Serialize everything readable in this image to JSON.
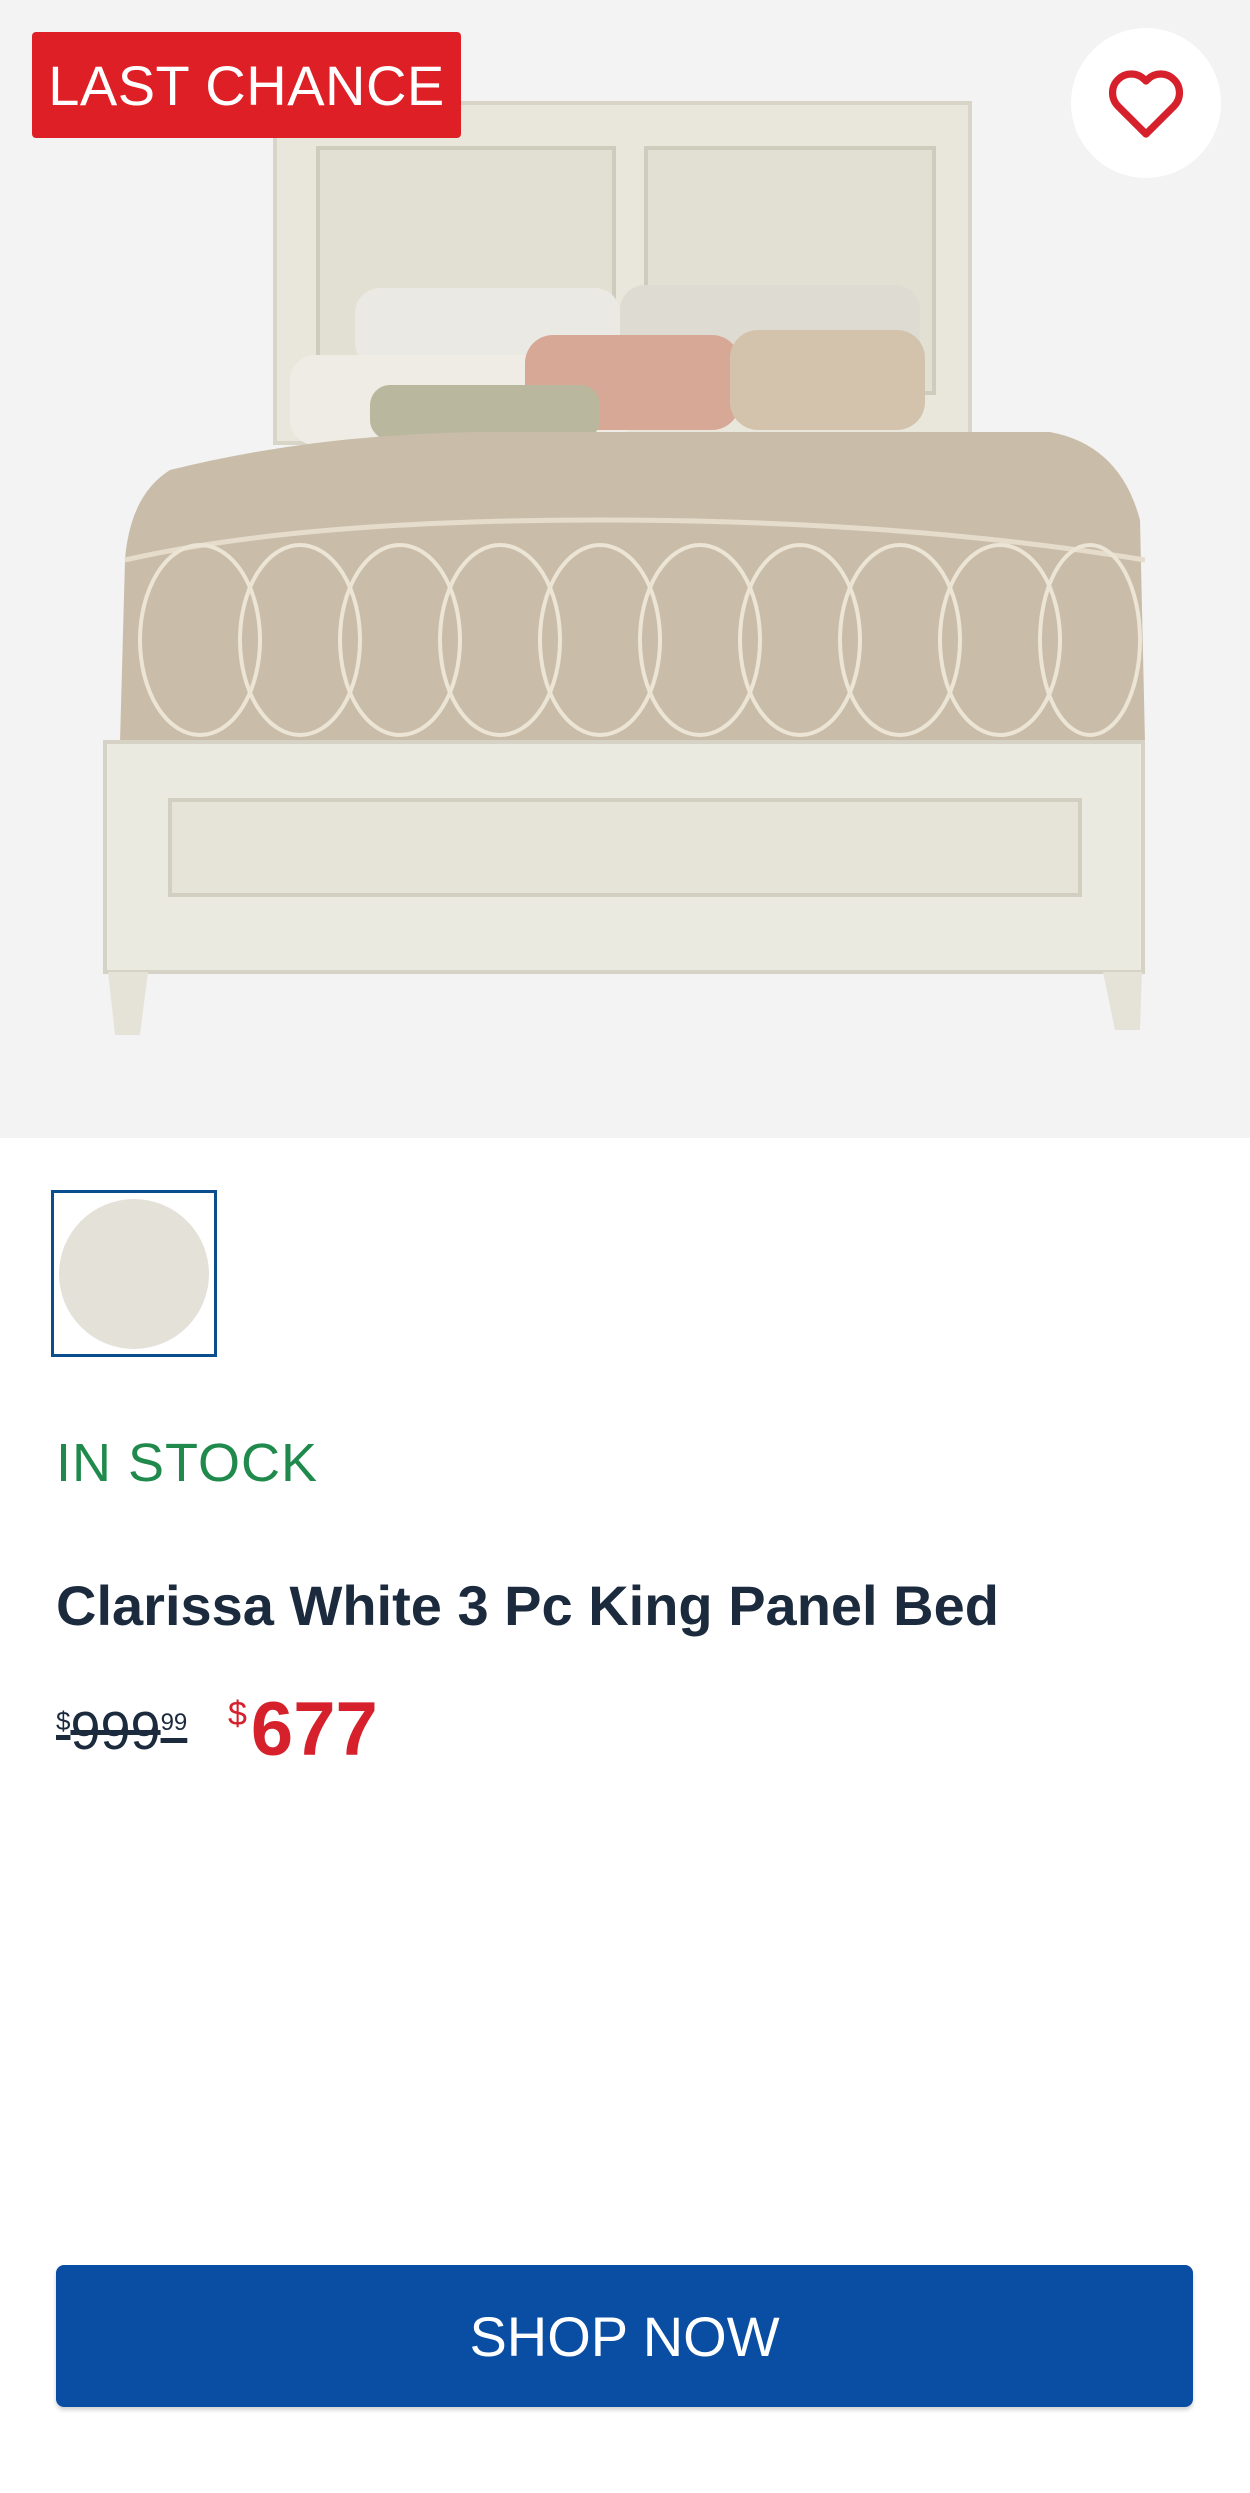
{
  "product": {
    "badge": "LAST CHANCE",
    "stock_status": "IN STOCK",
    "title": "Clarissa White 3 Pc King Panel Bed",
    "old_price": {
      "currency": "$",
      "dollars": "999",
      "cents": "99"
    },
    "sale_price": {
      "currency": "$",
      "dollars": "677"
    },
    "swatch_color": "#e4e1d9"
  },
  "cta": {
    "label": "SHOP NOW"
  },
  "colors": {
    "badge": "#df1f26",
    "heart": "#d6202b",
    "stock": "#1f8a4c",
    "cta": "#0a4ea3",
    "swatch_border": "#0a4e8f"
  },
  "icons": {
    "favorite": "heart-outline-icon"
  }
}
